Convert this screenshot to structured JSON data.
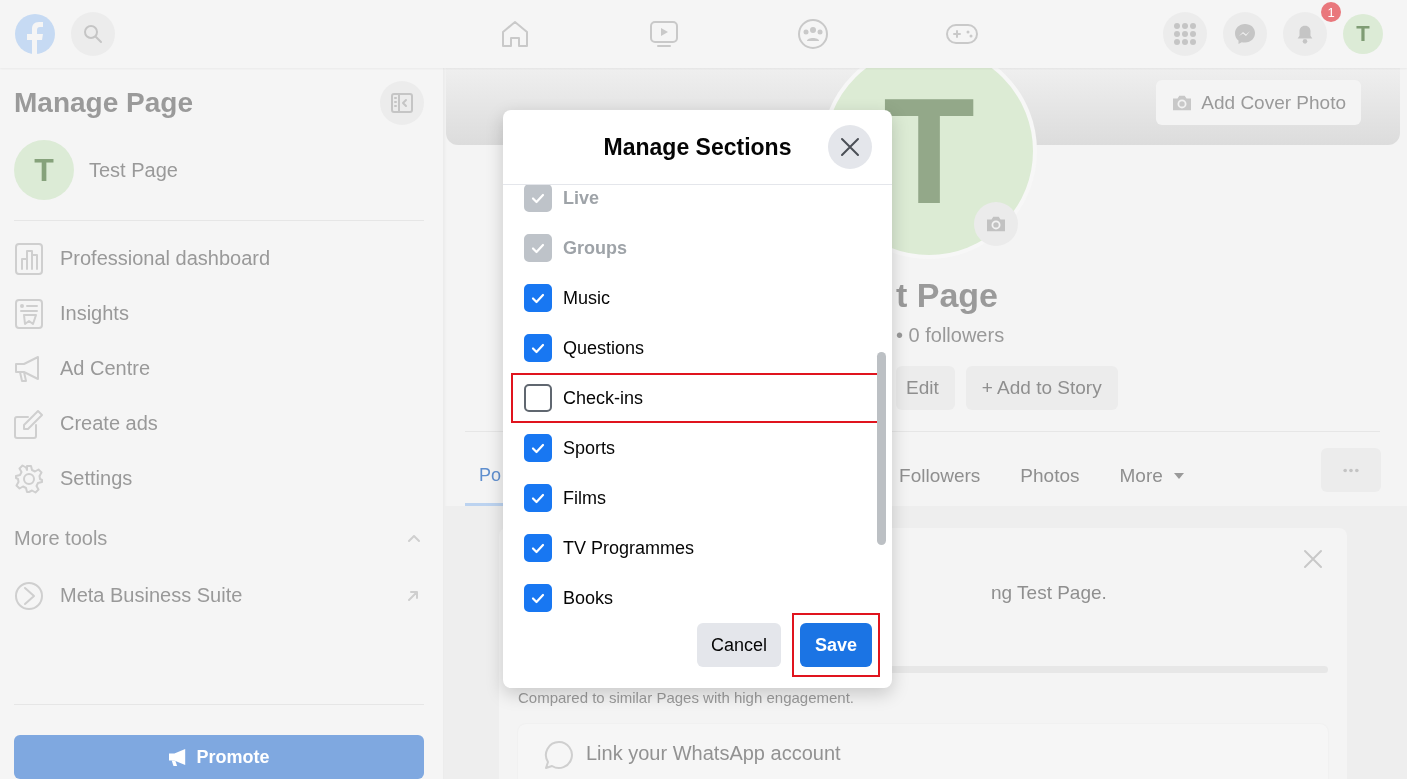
{
  "top_nav": {
    "notification_badge": "1",
    "avatar_letter": "T"
  },
  "sidebar": {
    "title": "Manage Page",
    "page_avatar_letter": "T",
    "page_name": "Test Page",
    "items": [
      {
        "label": "Professional dashboard",
        "kind": "dashboard"
      },
      {
        "label": "Insights",
        "kind": "insights"
      },
      {
        "label": "Ad Centre",
        "kind": "megaphone"
      },
      {
        "label": "Create ads",
        "kind": "edit"
      },
      {
        "label": "Settings",
        "kind": "settings"
      }
    ],
    "more_tools": {
      "label": "More tools",
      "expanded": true,
      "items": [
        {
          "label": "Meta Business Suite"
        }
      ]
    },
    "promote_button": "Promote"
  },
  "profile": {
    "cover_button": "Add Cover Photo",
    "avatar_letter": "T",
    "name": "t Page",
    "followers": "• 0 followers",
    "actions": [
      "Edit",
      "+ Add to Story"
    ],
    "tabs": [
      {
        "label": "Po",
        "selected": true,
        "dropdown": false
      },
      {
        "label": "Followers",
        "selected": false,
        "dropdown": false
      },
      {
        "label": "Photos",
        "selected": false,
        "dropdown": false
      },
      {
        "label": "More",
        "selected": false,
        "dropdown": true
      }
    ],
    "card": {
      "text": "ng Test Page.",
      "note": "Compared to similar Pages with high engagement.",
      "whatsapp": "Link your WhatsApp account"
    }
  },
  "modal": {
    "title": "Manage Sections",
    "sections": [
      {
        "label": "Live",
        "checked": true,
        "disabled": true,
        "highlighted": false
      },
      {
        "label": "Groups",
        "checked": true,
        "disabled": true,
        "highlighted": false
      },
      {
        "label": "Music",
        "checked": true,
        "disabled": false,
        "highlighted": false
      },
      {
        "label": "Questions",
        "checked": true,
        "disabled": false,
        "highlighted": false
      },
      {
        "label": "Check-ins",
        "checked": false,
        "disabled": false,
        "highlighted": true
      },
      {
        "label": "Sports",
        "checked": true,
        "disabled": false,
        "highlighted": false
      },
      {
        "label": "Films",
        "checked": true,
        "disabled": false,
        "highlighted": false
      },
      {
        "label": "TV Programmes",
        "checked": true,
        "disabled": false,
        "highlighted": false
      },
      {
        "label": "Books",
        "checked": true,
        "disabled": false,
        "highlighted": false
      }
    ],
    "buttons": [
      {
        "label": "Cancel",
        "kind": "secondary",
        "highlighted": false
      },
      {
        "label": "Save",
        "kind": "primary",
        "highlighted": true
      }
    ]
  }
}
